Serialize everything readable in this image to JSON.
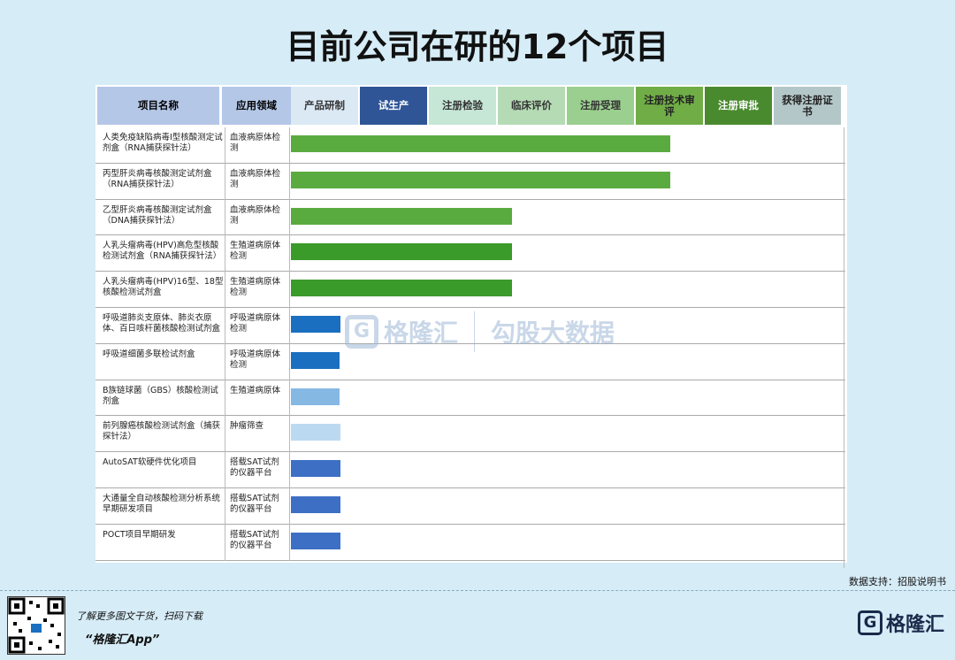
{
  "title": "目前公司在研的12个项目",
  "source": "数据支持：招股说明书",
  "footer": {
    "line1": "了解更多图文干货，扫码下载",
    "line2": "“格隆汇App”",
    "brand": "格隆汇",
    "brand_icon": "G-logo-icon"
  },
  "watermark": {
    "left": "格隆汇",
    "right": "勾股大数据"
  },
  "chart_data": {
    "type": "bar",
    "orientation": "horizontal",
    "headers": {
      "name_col": "项目名称",
      "domain_col": "应用领域",
      "stages": [
        {
          "label": "产品研制",
          "bg": "#dbe9f5",
          "fg": "#333333"
        },
        {
          "label": "试生产",
          "bg": "#2f5597",
          "fg": "#ffffff"
        },
        {
          "label": "注册检验",
          "bg": "#c6e6d6",
          "fg": "#333333"
        },
        {
          "label": "临床评价",
          "bg": "#b5dbb5",
          "fg": "#333333"
        },
        {
          "label": "注册受理",
          "bg": "#9bcf8f",
          "fg": "#333333"
        },
        {
          "label": "注册技术审评",
          "bg": "#70ad47",
          "fg": "#222222"
        },
        {
          "label": "注册审批",
          "bg": "#4a8a2f",
          "fg": "#ffffff"
        },
        {
          "label": "获得注册证书",
          "bg": "#b4c7c8",
          "fg": "#222222"
        }
      ],
      "name_col_bg": "#b4c7e7",
      "domain_col_bg": "#b4c7e7"
    },
    "rows": [
      {
        "name": "人类免疫缺陷病毒I型核酸测定试剂盒（RNA捕获探针法）",
        "domain": "血液病原体检测",
        "progress": 5.5,
        "color": "#5aab3f"
      },
      {
        "name": "丙型肝炎病毒核酸测定试剂盒（RNA捕获探针法）",
        "domain": "血液病原体检测",
        "progress": 5.5,
        "color": "#5aab3f"
      },
      {
        "name": "乙型肝炎病毒核酸测定试剂盒（DNA捕获探针法）",
        "domain": "血液病原体检测",
        "progress": 3.2,
        "color": "#5aab3f"
      },
      {
        "name": "人乳头瘤病毒(HPV)高危型核酸检测试剂盒（RNA捕获探针法）",
        "domain": "生殖道病原体检测",
        "progress": 3.2,
        "color": "#3a9a2a"
      },
      {
        "name": "人乳头瘤病毒(HPV)16型、18型核酸检测试剂盒",
        "domain": "生殖道病原体检测",
        "progress": 3.2,
        "color": "#3a9a2a"
      },
      {
        "name": "呼吸道肺炎支原体、肺炎衣原体、百日咳杆菌核酸检测试剂盒",
        "domain": "呼吸道病原体检测",
        "progress": 0.72,
        "color": "#1a6fc0"
      },
      {
        "name": "呼吸道细菌多联检试剂盒",
        "domain": "呼吸道病原体检测",
        "progress": 0.7,
        "color": "#1a6fc0"
      },
      {
        "name": "B族链球菌（GBS）核酸检测试剂盒",
        "domain": "生殖道病原体",
        "progress": 0.7,
        "color": "#86b8e4"
      },
      {
        "name": "前列腺癌核酸检测试剂盒（捕获探针法）",
        "domain": "肿瘤筛查",
        "progress": 0.72,
        "color": "#bcd9f2"
      },
      {
        "name": "AutoSAT软硬件优化项目",
        "domain": "搭载SAT试剂的仪器平台",
        "progress": 0.72,
        "color": "#3d6fc5"
      },
      {
        "name": "大通量全自动核酸检测分析系统早期研发项目",
        "domain": "搭载SAT试剂的仪器平台",
        "progress": 0.72,
        "color": "#3d6fc5"
      },
      {
        "name": "POCT项目早期研发",
        "domain": "搭载SAT试剂的仪器平台",
        "progress": 0.72,
        "color": "#3d6fc5"
      }
    ],
    "progress_unit": "stages"
  }
}
